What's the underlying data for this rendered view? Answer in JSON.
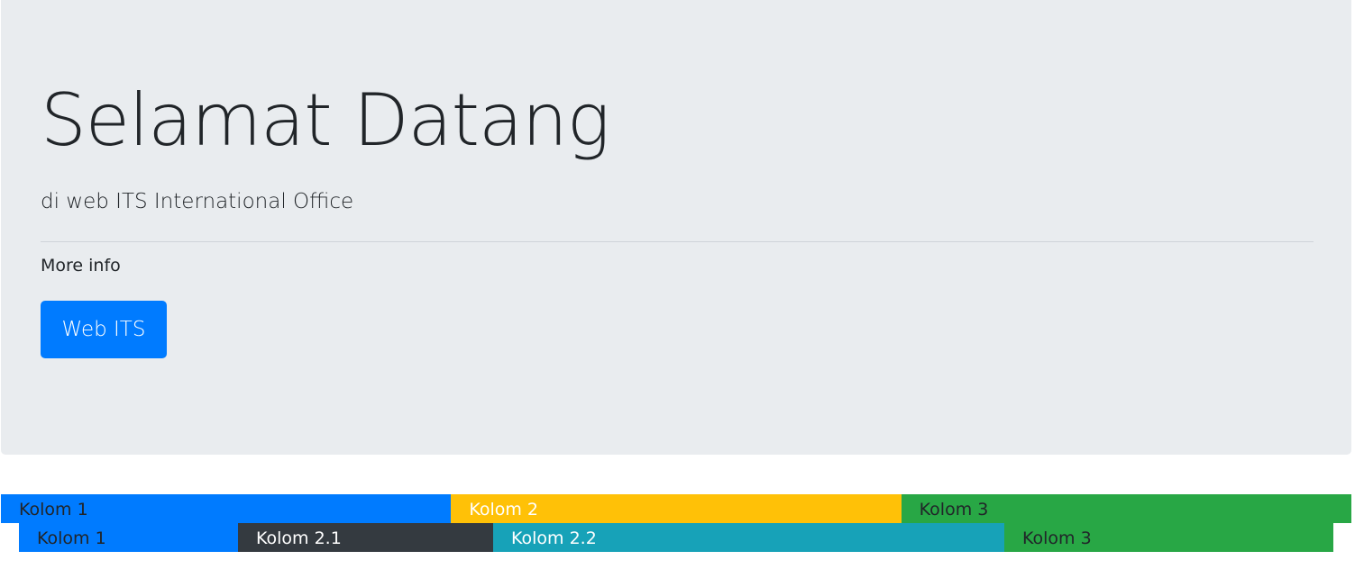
{
  "jumbotron": {
    "title": "Selamat Datang",
    "lead": "di web ITS International Office",
    "more_info": "More info",
    "button_label": "Web ITS"
  },
  "grid": {
    "row1": [
      {
        "label": "Kolom 1",
        "color": "#007bff"
      },
      {
        "label": "Kolom 2",
        "color": "#ffc107"
      },
      {
        "label": "Kolom 3",
        "color": "#28a745"
      }
    ],
    "row2": [
      {
        "label": "Kolom 1",
        "color": "#007bff"
      },
      {
        "label": "Kolom 2.1",
        "color": "#343a40"
      },
      {
        "label": "Kolom 2.2",
        "color": "#17a2b8"
      },
      {
        "label": "Kolom 3",
        "color": "#28a745"
      }
    ]
  }
}
